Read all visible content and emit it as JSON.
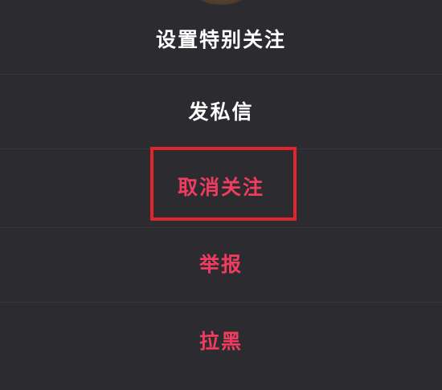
{
  "action_sheet": {
    "items": [
      {
        "label": "设置特别关注",
        "color": "#ffffff"
      },
      {
        "label": "发私信",
        "color": "#ffffff"
      },
      {
        "label": "取消关注",
        "color": "#f03c5f"
      },
      {
        "label": "举报",
        "color": "#f03c5f"
      },
      {
        "label": "拉黑",
        "color": "#f03c5f"
      }
    ]
  },
  "annotation": {
    "highlight_color": "#e2252b"
  }
}
